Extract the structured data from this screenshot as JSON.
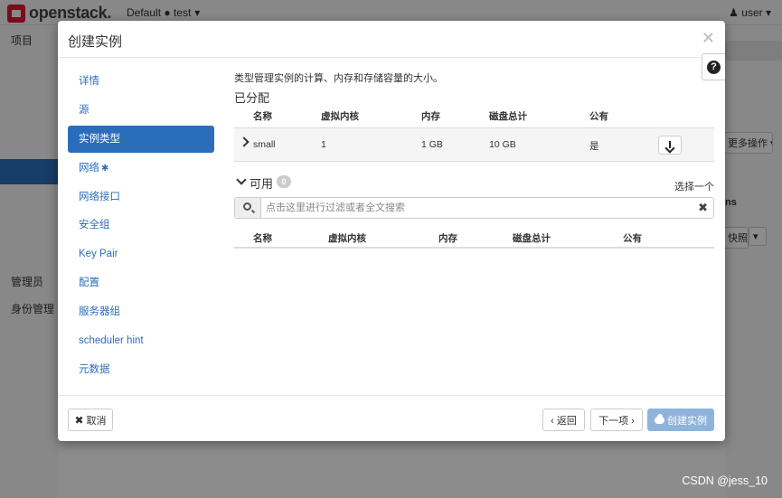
{
  "header": {
    "brand": "openstack.",
    "project_selector": "Default ● test",
    "user": "user"
  },
  "left_nav": {
    "project": "项目",
    "admin": "管理员",
    "identity": "身份管理"
  },
  "background_right": {
    "more_actions": "更多操作",
    "col_fragment": "ns",
    "snapshot_fragment": "快照"
  },
  "modal": {
    "title": "创建实例",
    "help": "?",
    "nav": [
      {
        "label": "详情",
        "required": false
      },
      {
        "label": "源",
        "required": false
      },
      {
        "label": "实例类型",
        "required": false,
        "active": true
      },
      {
        "label": "网络",
        "required": true,
        "required_mark": "✱"
      },
      {
        "label": "网络接口",
        "required": false
      },
      {
        "label": "安全组",
        "required": false
      },
      {
        "label": "Key Pair",
        "required": false
      },
      {
        "label": "配置",
        "required": false
      },
      {
        "label": "服务器组",
        "required": false
      },
      {
        "label": "scheduler hint",
        "required": false
      },
      {
        "label": "元数据",
        "required": false
      }
    ],
    "description": "类型管理实例的计算、内存和存储容量的大小。",
    "allocated": {
      "title": "已分配",
      "columns": [
        "名称",
        "虚拟内核",
        "内存",
        "磁盘总计",
        "公有"
      ],
      "rows": [
        {
          "name": "small",
          "vcpus": "1",
          "ram": "1 GB",
          "disk": "10 GB",
          "public": "是"
        }
      ]
    },
    "available": {
      "title": "可用",
      "count": "0",
      "choose_one": "选择一个",
      "search_placeholder": "点击这里进行过滤或者全文搜索",
      "columns": [
        "名称",
        "虚拟内核",
        "内存",
        "磁盘总计",
        "公有"
      ]
    },
    "footer": {
      "cancel": "取消",
      "back": "‹ 返回",
      "next": "下一项 ›",
      "create": "创建实例"
    }
  },
  "watermark": "CSDN @jess_10",
  "colors": {
    "primary": "#2a6ebb",
    "primary_disabled": "#8fb4dc",
    "brand_red": "#da1a32"
  }
}
